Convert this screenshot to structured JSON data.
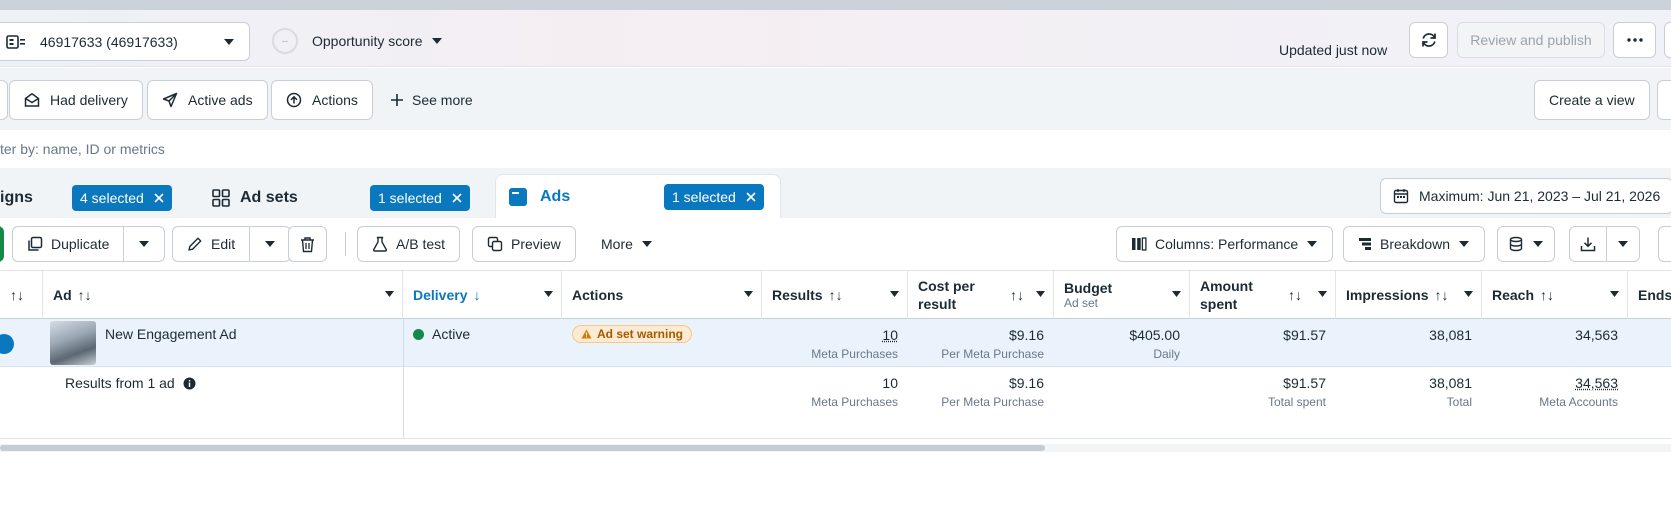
{
  "header": {
    "account_label": "46917633 (46917633)",
    "opportunity_label": "Opportunity score",
    "opportunity_value": "--",
    "updated_text": "Updated just now",
    "review_label": "Review and publish"
  },
  "filters": {
    "chips": [
      "Had delivery",
      "Active ads",
      "Actions"
    ],
    "see_more": "See more",
    "create_view": "Create a view"
  },
  "search": {
    "placeholder": "ter by: name, ID or metrics"
  },
  "tabs": {
    "campaigns": {
      "label": "igns",
      "badge": "4 selected"
    },
    "adsets": {
      "label": "Ad sets",
      "badge": "1 selected"
    },
    "ads": {
      "label": "Ads",
      "badge": "1 selected"
    },
    "date_range": "Maximum: Jun 21, 2023 – Jul 21, 2026"
  },
  "toolbar": {
    "duplicate": "Duplicate",
    "edit": "Edit",
    "ab_test": "A/B test",
    "preview": "Preview",
    "more": "More",
    "columns": "Columns: Performance",
    "breakdown": "Breakdown"
  },
  "table": {
    "headers": {
      "ad": "Ad",
      "delivery": "Delivery",
      "actions": "Actions",
      "results": "Results",
      "cost_per_result": "Cost per result",
      "budget": "Budget",
      "budget_sub": "Ad set",
      "amount_spent": "Amount spent",
      "impressions": "Impressions",
      "reach": "Reach",
      "ends": "Ends"
    },
    "row": {
      "ad_name": "New Engagement Ad",
      "delivery": "Active",
      "actions_badge": "Ad set warning",
      "results": "10",
      "results_sub": "Meta Purchases",
      "cost": "$9.16",
      "cost_sub": "Per Meta Purchase",
      "budget": "$405.00",
      "budget_sub": "Daily",
      "spent": "$91.57",
      "impressions": "38,081",
      "reach": "34,563"
    },
    "totals": {
      "label": "Results from 1 ad",
      "results": "10",
      "results_sub": "Meta Purchases",
      "cost": "$9.16",
      "cost_sub": "Per Meta Purchase",
      "spent": "$91.57",
      "spent_sub": "Total spent",
      "impressions": "38,081",
      "impressions_sub": "Total",
      "reach": "34,563",
      "reach_sub": "Meta Accounts"
    }
  },
  "colors": {
    "accent": "#0a78be",
    "active": "#138a4a",
    "warning_bg": "#fcebd2"
  }
}
